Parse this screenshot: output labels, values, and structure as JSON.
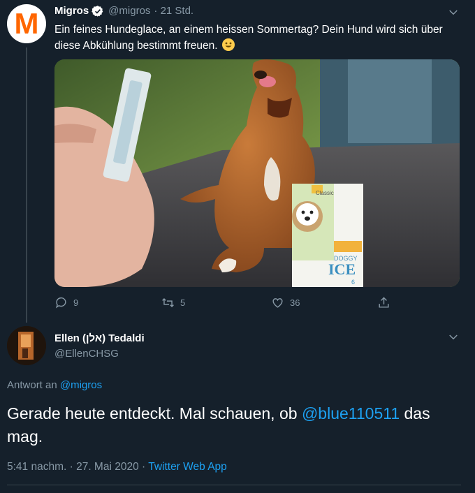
{
  "tweet": {
    "author_name": "Migros",
    "author_handle": "@migros",
    "time": "· 21 Std.",
    "avatar_letter": "M",
    "text": "Ein feines Hundeglace, an einem heissen Sommertag? Dein Hund wird sich über diese Abkühlung bestimmt freuen.",
    "media_alt": "Dog next to a box of Doggy Ice, person holding an ice stick",
    "product": {
      "brand": "Classic",
      "name_line1": "DOGGY",
      "name_line2": "ICE",
      "count": "6"
    },
    "actions": {
      "replies": "9",
      "retweets": "5",
      "likes": "36"
    }
  },
  "reply": {
    "author_name": "Ellen (אלן) Tedaldi",
    "author_handle": "@EllenCHSG",
    "reply_prefix": "Antwort an",
    "reply_target": "@migros",
    "text_before": "Gerade heute entdeckt. Mal schauen, ob",
    "mention": "@blue110511",
    "text_after": "das mag.",
    "timestamp": "5:41 nachm. · 27. Mai 2020 ·",
    "source": "Twitter Web App"
  },
  "colors": {
    "background": "#15202b",
    "muted": "#8899a6",
    "accent": "#1da1f2",
    "brand_orange": "#ff6600"
  }
}
